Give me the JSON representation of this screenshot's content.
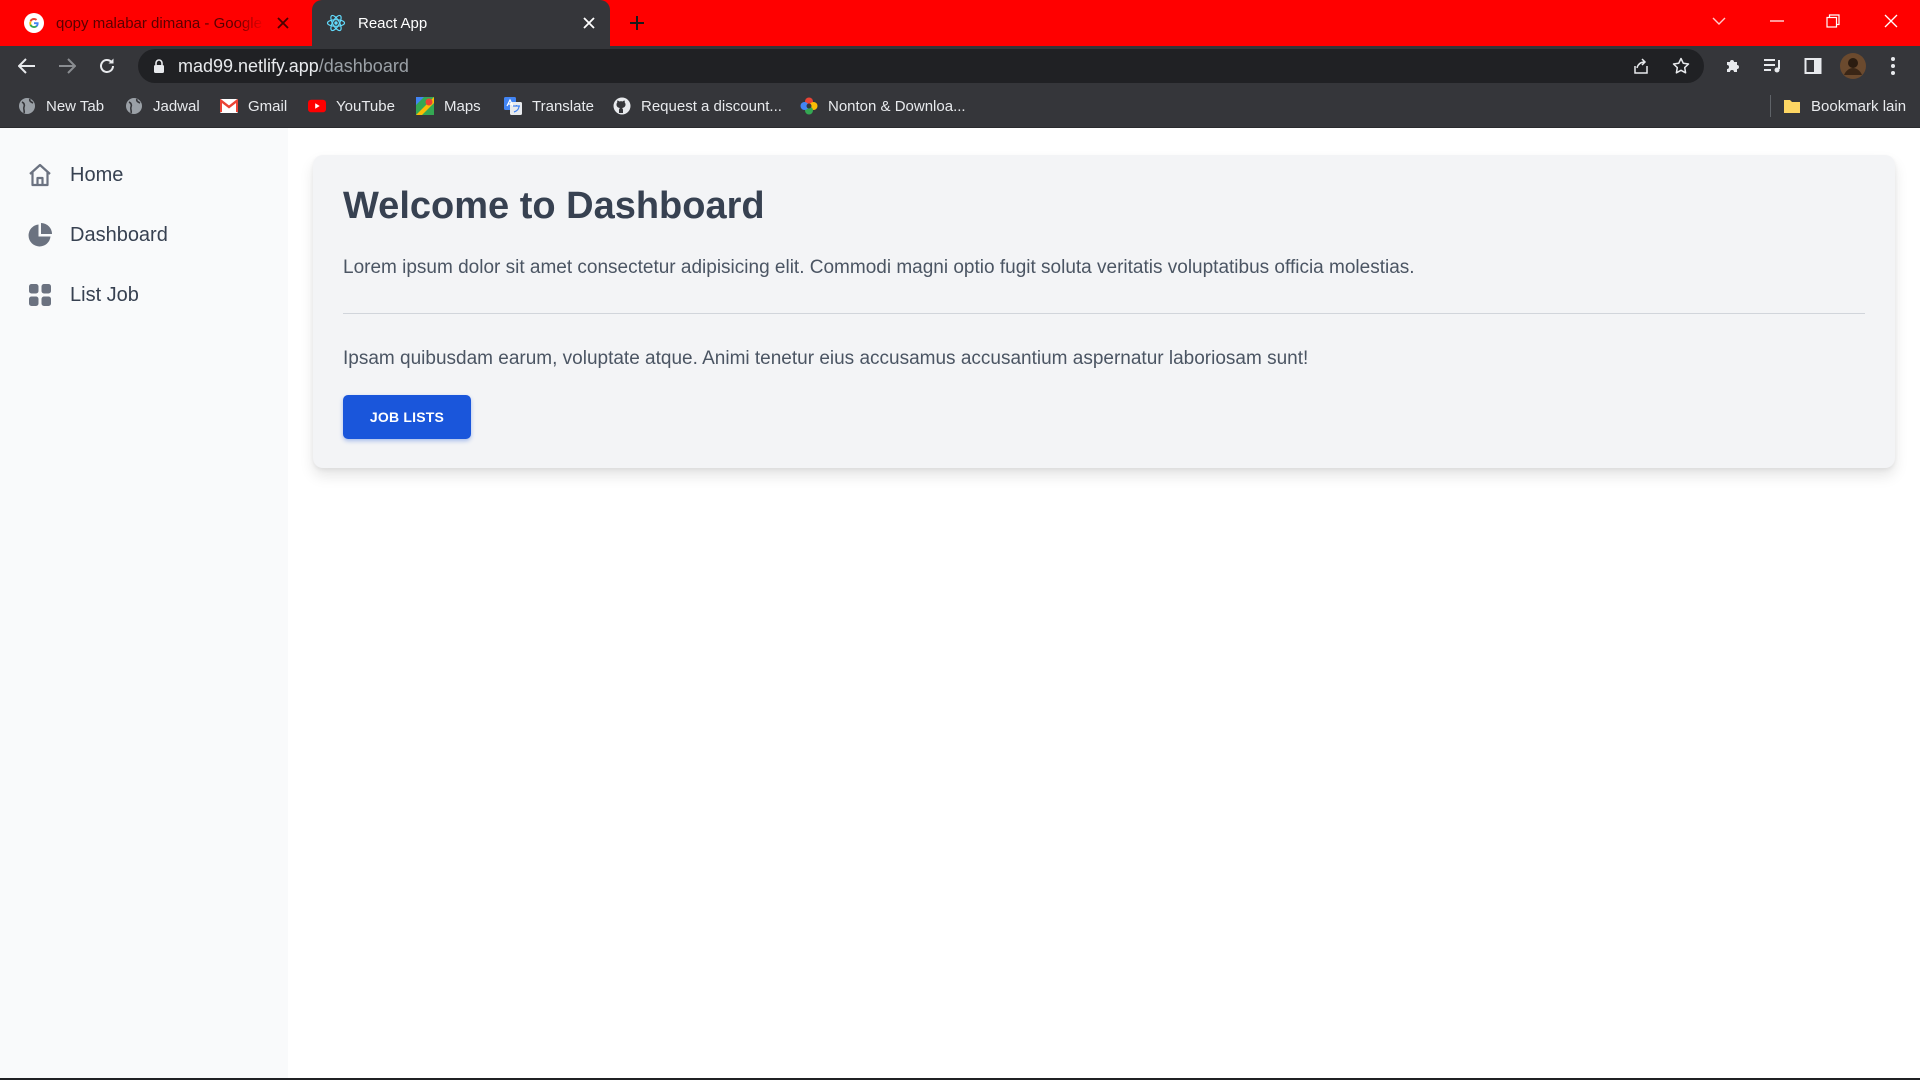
{
  "browser": {
    "tabs": [
      {
        "title": "qopy malabar dimana - Google S",
        "favicon": "google-g-icon",
        "active": false
      },
      {
        "title": "React App",
        "favicon": "react-atom-icon",
        "active": true
      }
    ],
    "address": {
      "host": "mad99.netlify.app",
      "path": "/dashboard"
    },
    "bookmarks": [
      {
        "label": "New Tab",
        "icon": "globe-icon"
      },
      {
        "label": "Jadwal",
        "icon": "globe-icon"
      },
      {
        "label": "Gmail",
        "icon": "gmail-icon"
      },
      {
        "label": "YouTube",
        "icon": "youtube-icon"
      },
      {
        "label": "Maps",
        "icon": "maps-icon"
      },
      {
        "label": "Translate",
        "icon": "translate-icon"
      },
      {
        "label": "Request a discount...",
        "icon": "github-icon"
      },
      {
        "label": "Nonton & Downloa...",
        "icon": "pinwheel-icon"
      }
    ],
    "other_bookmarks": "Bookmark lain",
    "colors": {
      "tabbar": "#ff0000",
      "toolbar": "#35363a",
      "omnibox": "#202124"
    }
  },
  "sidebar": {
    "items": [
      {
        "label": "Home",
        "icon": "home-icon"
      },
      {
        "label": "Dashboard",
        "icon": "pie-chart-icon"
      },
      {
        "label": "List Job",
        "icon": "grid-icon"
      }
    ]
  },
  "main": {
    "title": "Welcome to Dashboard",
    "intro": "Lorem ipsum dolor sit amet consectetur adipisicing elit. Commodi magni optio fugit soluta veritatis voluptatibus officia molestias.",
    "body": "Ipsam quibusdam earum, voluptate atque. Animi tenetur eius accusamus accusantium aspernatur laboriosam sunt!",
    "button_label": "JOB LISTS",
    "accent_color": "#1a56db"
  }
}
